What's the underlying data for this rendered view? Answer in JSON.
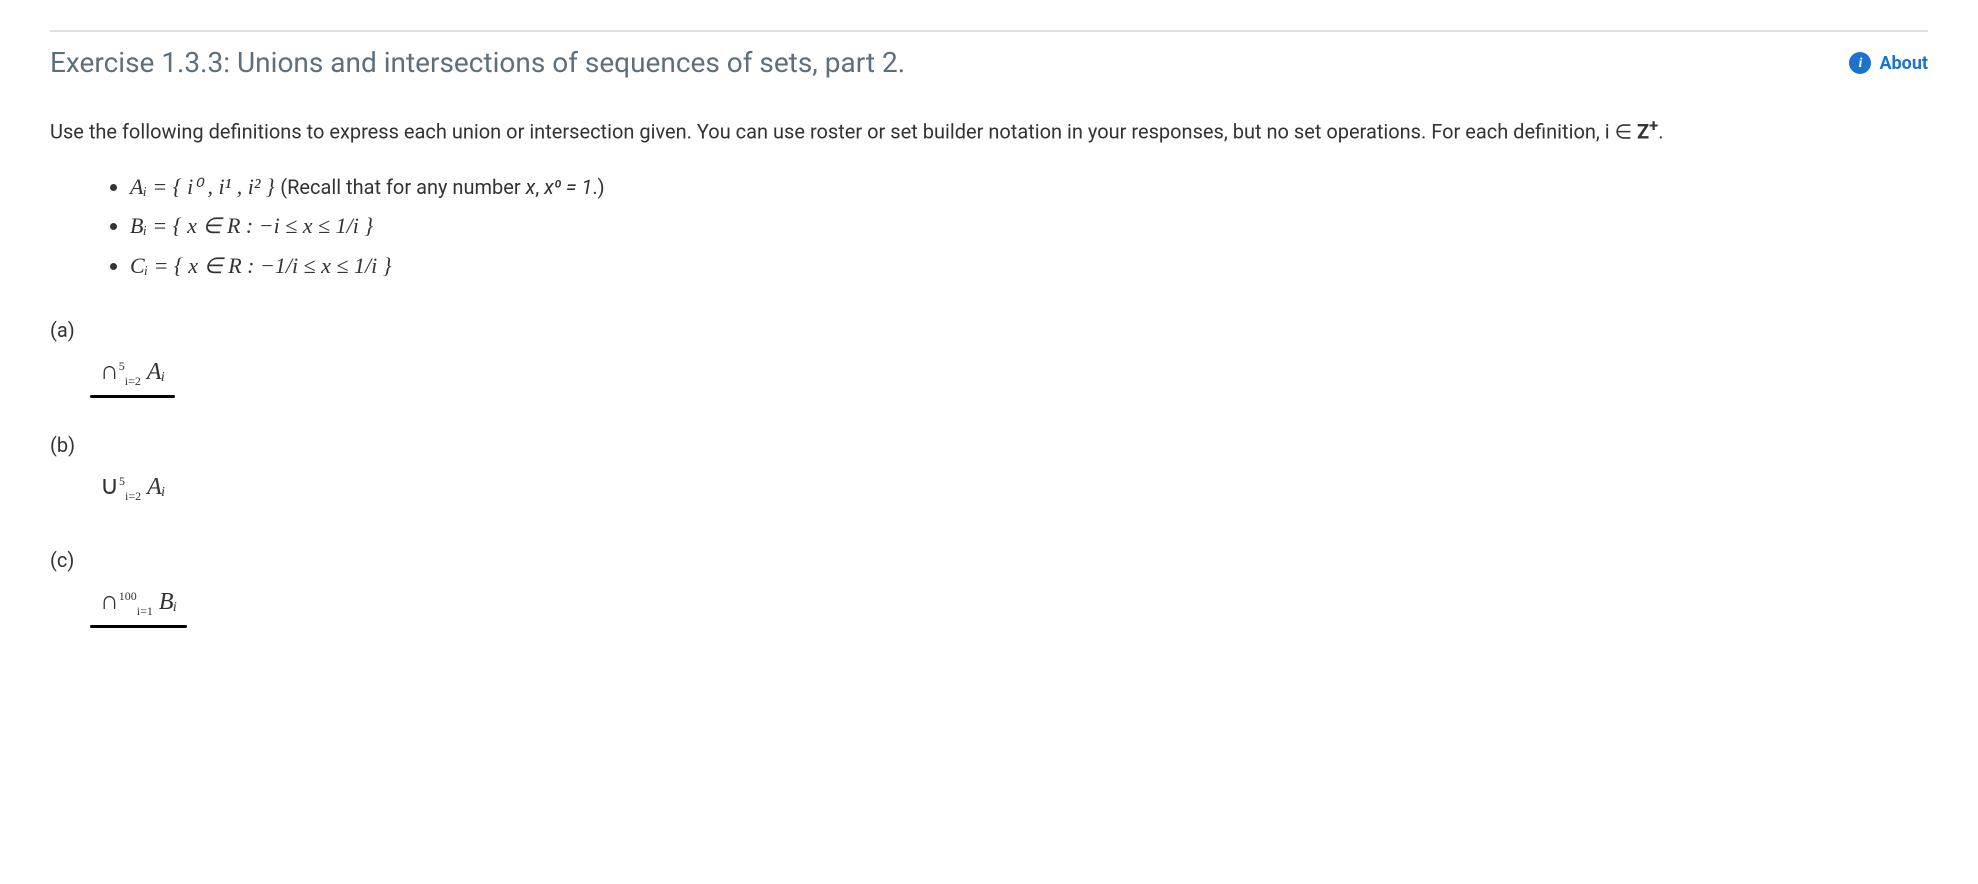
{
  "header": {
    "title": "Exercise 1.3.3: Unions and intersections of sequences of sets, part 2.",
    "about_label": "About"
  },
  "intro": {
    "line1": "Use the following definitions to express each union or intersection given. You can use roster or set builder notation in your responses, but no set operations. For each definition, i ∈ ",
    "set_symbol": "Z",
    "set_sup": "+",
    "period": "."
  },
  "definitions": [
    {
      "lhs": "Aᵢ = { i⁰ , i¹ , i² }",
      "note_prefix": " (Recall that for any number ",
      "note_var": "x",
      "note_mid": ", ",
      "note_expr": "x⁰ = 1",
      "note_suffix": ".)"
    },
    {
      "lhs": "Bᵢ = { x ∈ R : −i ≤ x ≤ 1/i }",
      "note_prefix": "",
      "note_var": "",
      "note_mid": "",
      "note_expr": "",
      "note_suffix": ""
    },
    {
      "lhs": "Cᵢ = { x ∈ R : −1/i ≤ x ≤ 1/i }",
      "note_prefix": "",
      "note_var": "",
      "note_mid": "",
      "note_expr": "",
      "note_suffix": ""
    }
  ],
  "parts": [
    {
      "label": "(a)",
      "op": "∩",
      "upper": "5",
      "lower": "i=2",
      "set": "Aᵢ",
      "underlined": true
    },
    {
      "label": "(b)",
      "op": "∪",
      "upper": "5",
      "lower": "i=2",
      "set": "Aᵢ",
      "underlined": false
    },
    {
      "label": "(c)",
      "op": "∩",
      "upper": "100",
      "lower": "i=1",
      "set": "Bᵢ",
      "underlined": true
    }
  ]
}
